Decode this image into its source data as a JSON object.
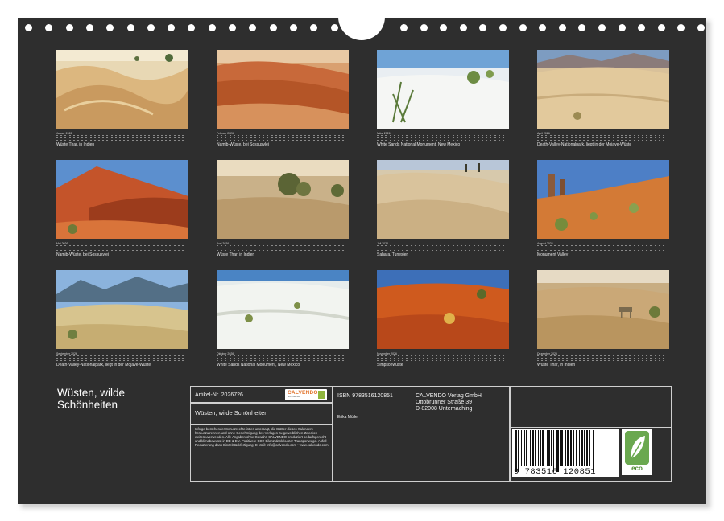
{
  "months": [
    {
      "label": "Januar 2026",
      "caption": "Wüste Thar, in Indien",
      "icon": "desert-dunes-photo"
    },
    {
      "label": "Februar 2026",
      "caption": "Namib-Wüste, bei Sossusvlei",
      "icon": "red-dunes-photo"
    },
    {
      "label": "März 2026",
      "caption": "White Sands National Monument, New Mexico",
      "icon": "white-sand-yucca-photo"
    },
    {
      "label": "April 2026",
      "caption": "Death-Valley-Nationalpark, liegt in der Mojave-Wüste",
      "icon": "death-valley-dunes-photo"
    },
    {
      "label": "Mai 2026",
      "caption": "Namib-Wüste, bei Sossusvlei",
      "icon": "red-dune-photo"
    },
    {
      "label": "Juni 2026",
      "caption": "Wüste Thar, in Indien",
      "icon": "desert-trees-photo"
    },
    {
      "label": "Juli 2026",
      "caption": "Sahara, Tunesien",
      "icon": "sahara-palms-photo"
    },
    {
      "label": "August 2026",
      "caption": "Monument Valley",
      "icon": "monument-valley-photo"
    },
    {
      "label": "September 2026",
      "caption": "Death-Valley-Nationalpark, liegt in der Mojave-Wüste",
      "icon": "mountains-dunes-photo"
    },
    {
      "label": "Oktober 2026",
      "caption": "White Sands National Monument, New Mexico",
      "icon": "white-sands-photo"
    },
    {
      "label": "November 2026",
      "caption": "Simpsonwüste",
      "icon": "red-sand-photo"
    },
    {
      "label": "Dezember 2026",
      "caption": "Wüste Thar, in Indien",
      "icon": "camel-desert-photo"
    }
  ],
  "back": {
    "title": "Wüsten, wilde Schönheiten",
    "article_number": "Artikel-Nr. 2026726",
    "product_name": "Wüsten, wilde Schönheiten",
    "isbn": "ISBN 9783516120851",
    "publisher_lines": [
      "CALVENDO Verlag GmbH",
      "Ottobrunner Straße 39",
      "D-82008 Unterhaching"
    ],
    "author": "Erika Müller",
    "logo_text": "CALVENDO",
    "logo_sub": "dein Kalender",
    "legal": "Infolge bestehender Schutzrechte ist es untersagt, die Blätter dieses Kalenders herauszutrennen und ohne Genehmigung des Verlages zu gewerblichen Zwecken weiterzuverwenden. Alle Angaben ohne Gewähr. CALVENDO produziert bedarfsgerecht und klimabewusst in DE & EU. Positivere CO2-Bilanz dank kurzer Transportwege. Abfall-Reduzierung dank Einzelstückfertigung. E-Mail: info@calvendo.com • www.calvendo.com",
    "barcode_number": "9 783516 120851",
    "eco_label": "eco"
  },
  "colors": {
    "page": "#2e2e2e",
    "eco_green": "#6aa84f",
    "calvendo_orange": "#e2722a"
  }
}
